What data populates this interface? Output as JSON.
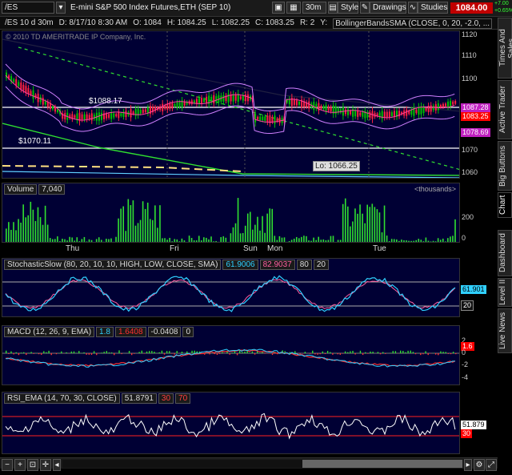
{
  "toolbar": {
    "symbol": "/ES",
    "description": "E-mini S&P 500 Index Futures,ETH (SEP 10)",
    "aggregation": "30m",
    "style_label": "Style",
    "drawings_label": "Drawings",
    "studies_label": "Studies",
    "last_price": "1084.00",
    "change": "+7.00",
    "change_pct": "+0.65%"
  },
  "quote_bar": {
    "title": "/ES 10 d 30m",
    "date": "D: 8/17/10 8:30 AM",
    "open": "O: 1084",
    "high": "H: 1084.25",
    "low": "L: 1082.25",
    "close": "C: 1083.25",
    "r": "R: 2",
    "y": "Y:",
    "study": "BollingerBandsSMA (CLOSE, 0, 20, -2.0, ..."
  },
  "price_panel": {
    "watermark": "© 2010 TD AMERITRADE IP Company, Inc.",
    "y_ticks": [
      "1120",
      "1110",
      "1100",
      "1090",
      "1080",
      "1070",
      "1060"
    ],
    "annotations": {
      "high_label": "$1088.17",
      "low_label": "$1070.11",
      "lo_callout": "Lo: 1066.25"
    },
    "price_tags": {
      "upper": "1087.28",
      "last": "1083.25",
      "lower": "1078.69"
    }
  },
  "volume_panel": {
    "header": "Volume",
    "value": "7,040",
    "units": "<thousands>",
    "y_ticks": [
      "200",
      "0"
    ],
    "x_labels": [
      "Thu",
      "Fri",
      "Sun",
      "Mon",
      "Tue"
    ]
  },
  "stoch_panel": {
    "header": "StochasticSlow (80, 20, 10, 10, HIGH, LOW, CLOSE, SMA)",
    "k": "61.9006",
    "d": "82.9037",
    "ob": "80",
    "os": "20",
    "tag_value": "61.901",
    "tag_os": "20"
  },
  "macd_panel": {
    "header": "MACD (12, 26, 9, EMA)",
    "value": "1.8",
    "avg": "1.6408",
    "diff": "-0.0408",
    "zero": "0",
    "y_ticks": [
      "2",
      "0",
      "-2",
      "-4"
    ],
    "tag_value": "1.6"
  },
  "rsi_panel": {
    "header": "RSI_EMA (14, 70, 30, CLOSE)",
    "value": "51.8791",
    "ob": "30",
    "os": "70",
    "tag_value": "51.879",
    "tag_os": "30"
  },
  "side_tabs": [
    "Times And Sales",
    "Active Trader",
    "Big Buttons",
    "Chart",
    "Dashboard",
    "Level II",
    "Live News"
  ],
  "colors": {
    "panel_bg": "#000034",
    "price_up": "#00c000",
    "price_down": "#ff2040",
    "band": "#d080ff",
    "trend": "#30e030",
    "k_line": "#30d0ff",
    "rsi_line": "#ffffff",
    "last_tag": "#ff0000"
  }
}
